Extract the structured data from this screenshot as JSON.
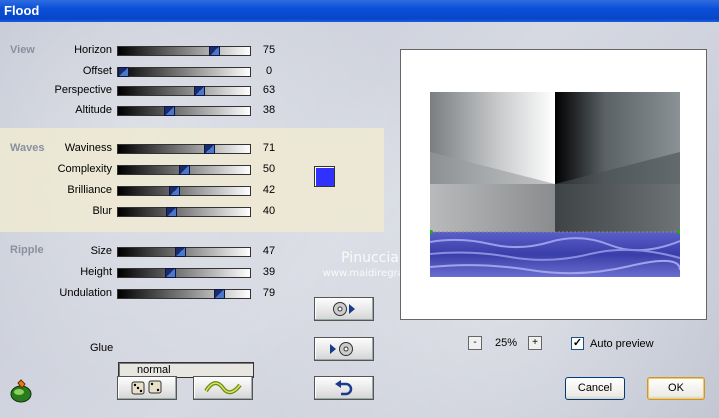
{
  "window": {
    "title": "Flood"
  },
  "groups": {
    "view": "View",
    "waves": "Waves",
    "ripple": "Ripple"
  },
  "params": [
    {
      "label": "Horizon",
      "value": "75"
    },
    {
      "label": "Offset",
      "value": "0"
    },
    {
      "label": "Perspective",
      "value": "63"
    },
    {
      "label": "Altitude",
      "value": "38"
    },
    {
      "label": "Waviness",
      "value": "71"
    },
    {
      "label": "Complexity",
      "value": "50"
    },
    {
      "label": "Brilliance",
      "value": "42"
    },
    {
      "label": "Blur",
      "value": "40"
    },
    {
      "label": "Size",
      "value": "47"
    },
    {
      "label": "Height",
      "value": "39"
    },
    {
      "label": "Undulation",
      "value": "79"
    }
  ],
  "slider_levels_percent": [
    75,
    0,
    63,
    38,
    71,
    50,
    42,
    40,
    47,
    39,
    79
  ],
  "wave_color": "#3030ff",
  "glue": {
    "label": "Glue",
    "value": "normal"
  },
  "zoom": {
    "minus": "-",
    "value": "25%",
    "plus": "+"
  },
  "auto_preview": {
    "label": "Auto preview",
    "checked": true,
    "check_mark": "✓"
  },
  "buttons": {
    "cancel": "Cancel",
    "ok": "OK"
  },
  "icons": {
    "app": "filter-plugin-icon",
    "randomize": "dice-icon",
    "reset": "wave-icon",
    "save_preset": "disc-arrow-right-icon",
    "load_preset": "arrow-disc-icon",
    "undo": "undo-arrow-icon"
  },
  "watermark": {
    "name": "Pinuccia",
    "url": "www.maidiregrafica.eu"
  }
}
